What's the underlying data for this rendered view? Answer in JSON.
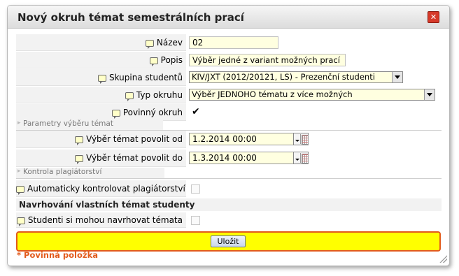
{
  "dialog": {
    "title": "Nový okruh témat semestrálních prací",
    "close_label": "✕"
  },
  "fields": {
    "nazev": {
      "label": "Název",
      "value": "02"
    },
    "popis": {
      "label": "Popis",
      "value": "Výběr jedné z variant možných prací"
    },
    "skupina": {
      "label": "Skupina studentů",
      "value": "KIV/JXT (2012/20121, LS) - Prezenční studenti"
    },
    "typ": {
      "label": "Typ okruhu",
      "value": "Výběr JEDNOHO tématu z více možných"
    },
    "povinny": {
      "label": "Povinný okruh",
      "checked": true
    }
  },
  "sections": {
    "parametry": "Parametry výběru témat",
    "kontrola": "Kontrola plagiátorství",
    "navrhovani": "Navrhování vlastních témat studenty"
  },
  "vyber": {
    "od": {
      "label": "Výběr témat povolit od",
      "value": "1.2.2014 00:00"
    },
    "do": {
      "label": "Výběr témat povolit do",
      "value": "1.3.2014 00:00"
    }
  },
  "plagiat": {
    "label": "Automaticky kontrolovat plagiátorství?",
    "checked": false
  },
  "navrh": {
    "label": "Studenti si mohou navrhovat témata",
    "checked": false
  },
  "actions": {
    "save_label": "Uložit"
  },
  "required_note": "* Povinná položka"
}
